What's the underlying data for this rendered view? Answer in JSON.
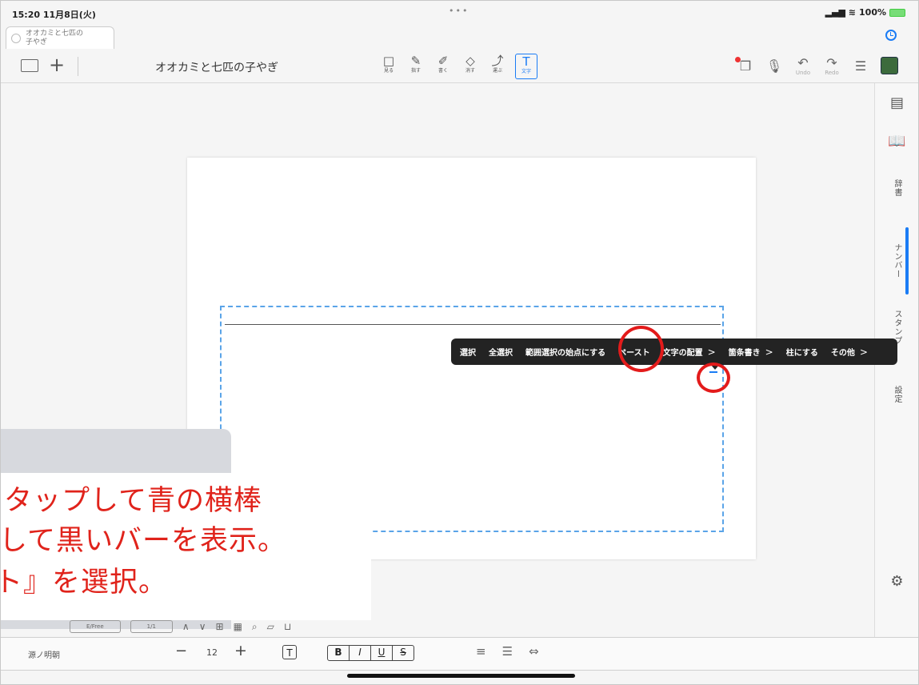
{
  "status": {
    "time": "15:20  11月8日(火)",
    "dots": "•••",
    "battery": "100%"
  },
  "doc_tab": {
    "line1": "オオカミと七匹の",
    "line2": "子やぎ"
  },
  "toolbar": {
    "title": "オオカミと七匹の子やぎ",
    "tools": [
      {
        "icon": "□",
        "label": "見る",
        "name": "view-tool"
      },
      {
        "icon": "✎",
        "label": "指す",
        "name": "point-tool"
      },
      {
        "icon": "✐",
        "label": "書く",
        "name": "write-tool"
      },
      {
        "icon": "◇",
        "label": "消す",
        "name": "erase-tool"
      },
      {
        "icon": "⤴",
        "label": "運ぶ",
        "name": "carry-tool"
      },
      {
        "icon": "T",
        "label": "文字",
        "name": "text-tool"
      }
    ],
    "undo": "Undo",
    "redo": "Redo"
  },
  "sidebar": {
    "dictionary": "辞書",
    "number": "ナンバー",
    "stamp": "スタンプ",
    "settings": "設定"
  },
  "context_menu": {
    "items": [
      "選択",
      "全選択",
      "範囲選択の始点にする",
      "ペースト",
      "文字の配置",
      "箇条書き",
      "柱にする",
      "その他"
    ]
  },
  "annotation": {
    "line1": "をタップして青の横棒",
    "line2": "プして黒いバーを表示。",
    "line3": "スト』を選択。"
  },
  "lower_toolbar": {
    "mode": "E/Free",
    "page": "1/1"
  },
  "format_bar": {
    "font": "源ノ明朝",
    "minus": "−",
    "size": "12",
    "plus": "+",
    "T": "T",
    "bold": "B",
    "italic": "I",
    "underline": "U",
    "strike": "S"
  }
}
